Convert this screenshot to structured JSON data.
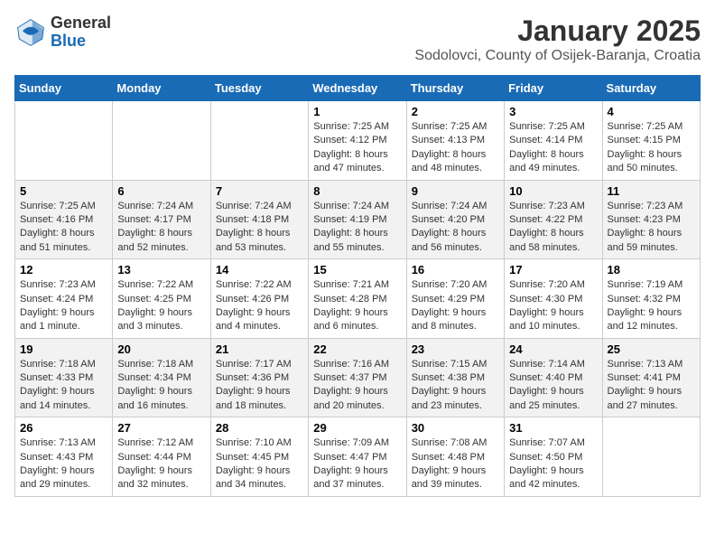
{
  "logo": {
    "general": "General",
    "blue": "Blue"
  },
  "header": {
    "month": "January 2025",
    "location": "Sodolovci, County of Osijek-Baranja, Croatia"
  },
  "weekdays": [
    "Sunday",
    "Monday",
    "Tuesday",
    "Wednesday",
    "Thursday",
    "Friday",
    "Saturday"
  ],
  "weeks": [
    [
      {
        "day": "",
        "info": ""
      },
      {
        "day": "",
        "info": ""
      },
      {
        "day": "",
        "info": ""
      },
      {
        "day": "1",
        "info": "Sunrise: 7:25 AM\nSunset: 4:12 PM\nDaylight: 8 hours and 47 minutes."
      },
      {
        "day": "2",
        "info": "Sunrise: 7:25 AM\nSunset: 4:13 PM\nDaylight: 8 hours and 48 minutes."
      },
      {
        "day": "3",
        "info": "Sunrise: 7:25 AM\nSunset: 4:14 PM\nDaylight: 8 hours and 49 minutes."
      },
      {
        "day": "4",
        "info": "Sunrise: 7:25 AM\nSunset: 4:15 PM\nDaylight: 8 hours and 50 minutes."
      }
    ],
    [
      {
        "day": "5",
        "info": "Sunrise: 7:25 AM\nSunset: 4:16 PM\nDaylight: 8 hours and 51 minutes."
      },
      {
        "day": "6",
        "info": "Sunrise: 7:24 AM\nSunset: 4:17 PM\nDaylight: 8 hours and 52 minutes."
      },
      {
        "day": "7",
        "info": "Sunrise: 7:24 AM\nSunset: 4:18 PM\nDaylight: 8 hours and 53 minutes."
      },
      {
        "day": "8",
        "info": "Sunrise: 7:24 AM\nSunset: 4:19 PM\nDaylight: 8 hours and 55 minutes."
      },
      {
        "day": "9",
        "info": "Sunrise: 7:24 AM\nSunset: 4:20 PM\nDaylight: 8 hours and 56 minutes."
      },
      {
        "day": "10",
        "info": "Sunrise: 7:23 AM\nSunset: 4:22 PM\nDaylight: 8 hours and 58 minutes."
      },
      {
        "day": "11",
        "info": "Sunrise: 7:23 AM\nSunset: 4:23 PM\nDaylight: 8 hours and 59 minutes."
      }
    ],
    [
      {
        "day": "12",
        "info": "Sunrise: 7:23 AM\nSunset: 4:24 PM\nDaylight: 9 hours and 1 minute."
      },
      {
        "day": "13",
        "info": "Sunrise: 7:22 AM\nSunset: 4:25 PM\nDaylight: 9 hours and 3 minutes."
      },
      {
        "day": "14",
        "info": "Sunrise: 7:22 AM\nSunset: 4:26 PM\nDaylight: 9 hours and 4 minutes."
      },
      {
        "day": "15",
        "info": "Sunrise: 7:21 AM\nSunset: 4:28 PM\nDaylight: 9 hours and 6 minutes."
      },
      {
        "day": "16",
        "info": "Sunrise: 7:20 AM\nSunset: 4:29 PM\nDaylight: 9 hours and 8 minutes."
      },
      {
        "day": "17",
        "info": "Sunrise: 7:20 AM\nSunset: 4:30 PM\nDaylight: 9 hours and 10 minutes."
      },
      {
        "day": "18",
        "info": "Sunrise: 7:19 AM\nSunset: 4:32 PM\nDaylight: 9 hours and 12 minutes."
      }
    ],
    [
      {
        "day": "19",
        "info": "Sunrise: 7:18 AM\nSunset: 4:33 PM\nDaylight: 9 hours and 14 minutes."
      },
      {
        "day": "20",
        "info": "Sunrise: 7:18 AM\nSunset: 4:34 PM\nDaylight: 9 hours and 16 minutes."
      },
      {
        "day": "21",
        "info": "Sunrise: 7:17 AM\nSunset: 4:36 PM\nDaylight: 9 hours and 18 minutes."
      },
      {
        "day": "22",
        "info": "Sunrise: 7:16 AM\nSunset: 4:37 PM\nDaylight: 9 hours and 20 minutes."
      },
      {
        "day": "23",
        "info": "Sunrise: 7:15 AM\nSunset: 4:38 PM\nDaylight: 9 hours and 23 minutes."
      },
      {
        "day": "24",
        "info": "Sunrise: 7:14 AM\nSunset: 4:40 PM\nDaylight: 9 hours and 25 minutes."
      },
      {
        "day": "25",
        "info": "Sunrise: 7:13 AM\nSunset: 4:41 PM\nDaylight: 9 hours and 27 minutes."
      }
    ],
    [
      {
        "day": "26",
        "info": "Sunrise: 7:13 AM\nSunset: 4:43 PM\nDaylight: 9 hours and 29 minutes."
      },
      {
        "day": "27",
        "info": "Sunrise: 7:12 AM\nSunset: 4:44 PM\nDaylight: 9 hours and 32 minutes."
      },
      {
        "day": "28",
        "info": "Sunrise: 7:10 AM\nSunset: 4:45 PM\nDaylight: 9 hours and 34 minutes."
      },
      {
        "day": "29",
        "info": "Sunrise: 7:09 AM\nSunset: 4:47 PM\nDaylight: 9 hours and 37 minutes."
      },
      {
        "day": "30",
        "info": "Sunrise: 7:08 AM\nSunset: 4:48 PM\nDaylight: 9 hours and 39 minutes."
      },
      {
        "day": "31",
        "info": "Sunrise: 7:07 AM\nSunset: 4:50 PM\nDaylight: 9 hours and 42 minutes."
      },
      {
        "day": "",
        "info": ""
      }
    ]
  ]
}
